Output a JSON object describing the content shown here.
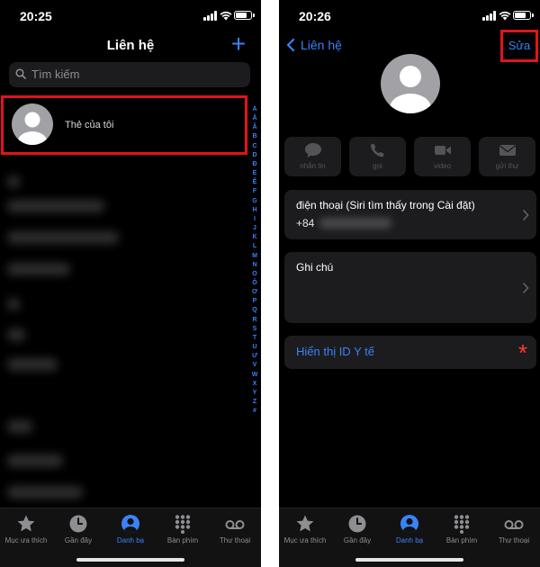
{
  "left": {
    "status_time": "20:25",
    "title": "Liên hệ",
    "add_glyph": "+",
    "search_placeholder": "Tìm kiếm",
    "my_card_label": "Thẻ của tôi",
    "index_letters": [
      "A",
      "Ă",
      "Â",
      "B",
      "C",
      "D",
      "Đ",
      "E",
      "Ê",
      "F",
      "G",
      "H",
      "I",
      "J",
      "K",
      "L",
      "M",
      "N",
      "O",
      "Ô",
      "Ơ",
      "P",
      "Q",
      "R",
      "S",
      "T",
      "U",
      "Ư",
      "V",
      "W",
      "X",
      "Y",
      "Z",
      "#"
    ]
  },
  "right": {
    "status_time": "20:26",
    "back_label": "Liên hệ",
    "edit_label": "Sửa",
    "actions": [
      {
        "label": "nhắn tin",
        "icon": "message-icon"
      },
      {
        "label": "gọi",
        "icon": "phone-icon"
      },
      {
        "label": "video",
        "icon": "video-icon"
      },
      {
        "label": "gửi thư",
        "icon": "mail-icon"
      }
    ],
    "phone_title": "điện thoại (Siri tìm thấy trong Cài đặt)",
    "phone_prefix": "+84",
    "notes_title": "Ghi chú",
    "medical_label": "Hiển thị ID Y tế",
    "medical_star": "*"
  },
  "tabbar": {
    "items": [
      {
        "label": "Mục ưa thích",
        "icon": "star-icon"
      },
      {
        "label": "Gần đây",
        "icon": "clock-icon"
      },
      {
        "label": "Danh bạ",
        "icon": "contacts-icon",
        "active": true
      },
      {
        "label": "Bàn phím",
        "icon": "keypad-icon"
      },
      {
        "label": "Thư thoại",
        "icon": "voicemail-icon"
      }
    ]
  },
  "colors": {
    "accent": "#3a82f7",
    "highlight_box": "#e0151b",
    "background": "#000000",
    "cell": "#1c1c1e",
    "medical_star": "#ff3b30"
  }
}
